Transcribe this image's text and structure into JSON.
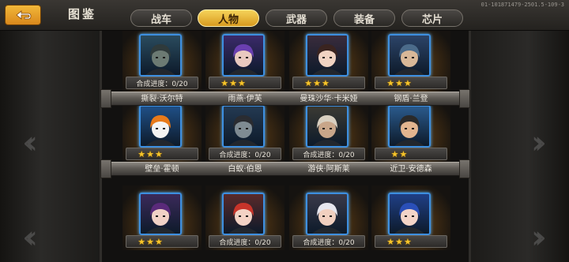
{
  "header": {
    "back_icon": "return-arrow-icon",
    "title": "图鉴",
    "build_info": "01-101871479-2501.5-109-3",
    "tabs": [
      {
        "label": "战车",
        "active": false
      },
      {
        "label": "人物",
        "active": true
      },
      {
        "label": "武器",
        "active": false
      },
      {
        "label": "装备",
        "active": false
      },
      {
        "label": "芯片",
        "active": false
      }
    ]
  },
  "colors": {
    "active_tab": "#e6b437",
    "card_border": "#3d8fe0",
    "star": "#f7c52a"
  },
  "rows": [
    {
      "cards": [
        {
          "status": "progress",
          "progress_text": "合成进度：0/20",
          "stars": 0,
          "portrait": "hooded-soldier-portrait",
          "bg": "#2a4b5e",
          "hair": "#2f3a3b",
          "skin": "#6c7a73"
        },
        {
          "status": "stars",
          "progress_text": "",
          "stars": 3,
          "portrait": "purple-hair-girl-portrait",
          "bg": "#3b2a6a",
          "hair": "#6a3fb0",
          "skin": "#e9c9c0"
        },
        {
          "status": "stars",
          "progress_text": "",
          "stars": 3,
          "portrait": "dark-hair-woman-portrait",
          "bg": "#3a2c3c",
          "hair": "#3a2420",
          "skin": "#f0d3c2"
        },
        {
          "status": "stars",
          "progress_text": "",
          "stars": 3,
          "portrait": "cyborg-man-portrait",
          "bg": "#2c4468",
          "hair": "#4b6b8a",
          "skin": "#d8b898"
        }
      ],
      "names": [
        "撕裂·沃尔特",
        "雨燕·伊芙",
        "曼珠沙华·卡米娅",
        "钢盾·兰登"
      ]
    },
    {
      "cards": [
        {
          "status": "stars",
          "progress_text": "",
          "stars": 3,
          "portrait": "orange-robot-portrait",
          "bg": "#1f4f86",
          "hair": "#e87a1a",
          "skin": "#f3f3f3"
        },
        {
          "status": "progress",
          "progress_text": "合成进度：0/20",
          "stars": 0,
          "portrait": "dark-suit-man-portrait",
          "bg": "#243a52",
          "hair": "#2a2c31",
          "skin": "#7f8b92"
        },
        {
          "status": "progress",
          "progress_text": "合成进度：0/20",
          "stars": 0,
          "portrait": "cowboy-hat-man-portrait",
          "bg": "#3b3a33",
          "hair": "#d8cfc0",
          "skin": "#c8a68a"
        },
        {
          "status": "stars",
          "progress_text": "",
          "stars": 2,
          "portrait": "headband-soldier-portrait",
          "bg": "#2a5a8c",
          "hair": "#2a2a2a",
          "skin": "#e2b58f"
        }
      ],
      "names": [
        "壁垒·霍顿",
        "白蚁·伯恩",
        "游侠·阿斯莱",
        "近卫·安德森"
      ]
    },
    {
      "cards": [
        {
          "status": "stars",
          "progress_text": "",
          "stars": 3,
          "portrait": "cap-girl-portrait",
          "bg": "#3b2a5a",
          "hair": "#5a2a7a",
          "skin": "#f2d1c6"
        },
        {
          "status": "progress",
          "progress_text": "合成进度：0/20",
          "stars": 0,
          "portrait": "red-hair-girl-portrait",
          "bg": "#5a2a2a",
          "hair": "#c8342a",
          "skin": "#f3d2c4"
        },
        {
          "status": "progress",
          "progress_text": "合成进度：0/20",
          "stars": 0,
          "portrait": "white-hair-boy-portrait",
          "bg": "#3a3a4a",
          "hair": "#e6e6ee",
          "skin": "#f1d0c0"
        },
        {
          "status": "stars",
          "progress_text": "",
          "stars": 3,
          "portrait": "blue-hair-girl-portrait",
          "bg": "#1f3f86",
          "hair": "#2a4fb8",
          "skin": "#f3d4c8"
        }
      ],
      "names": []
    }
  ]
}
